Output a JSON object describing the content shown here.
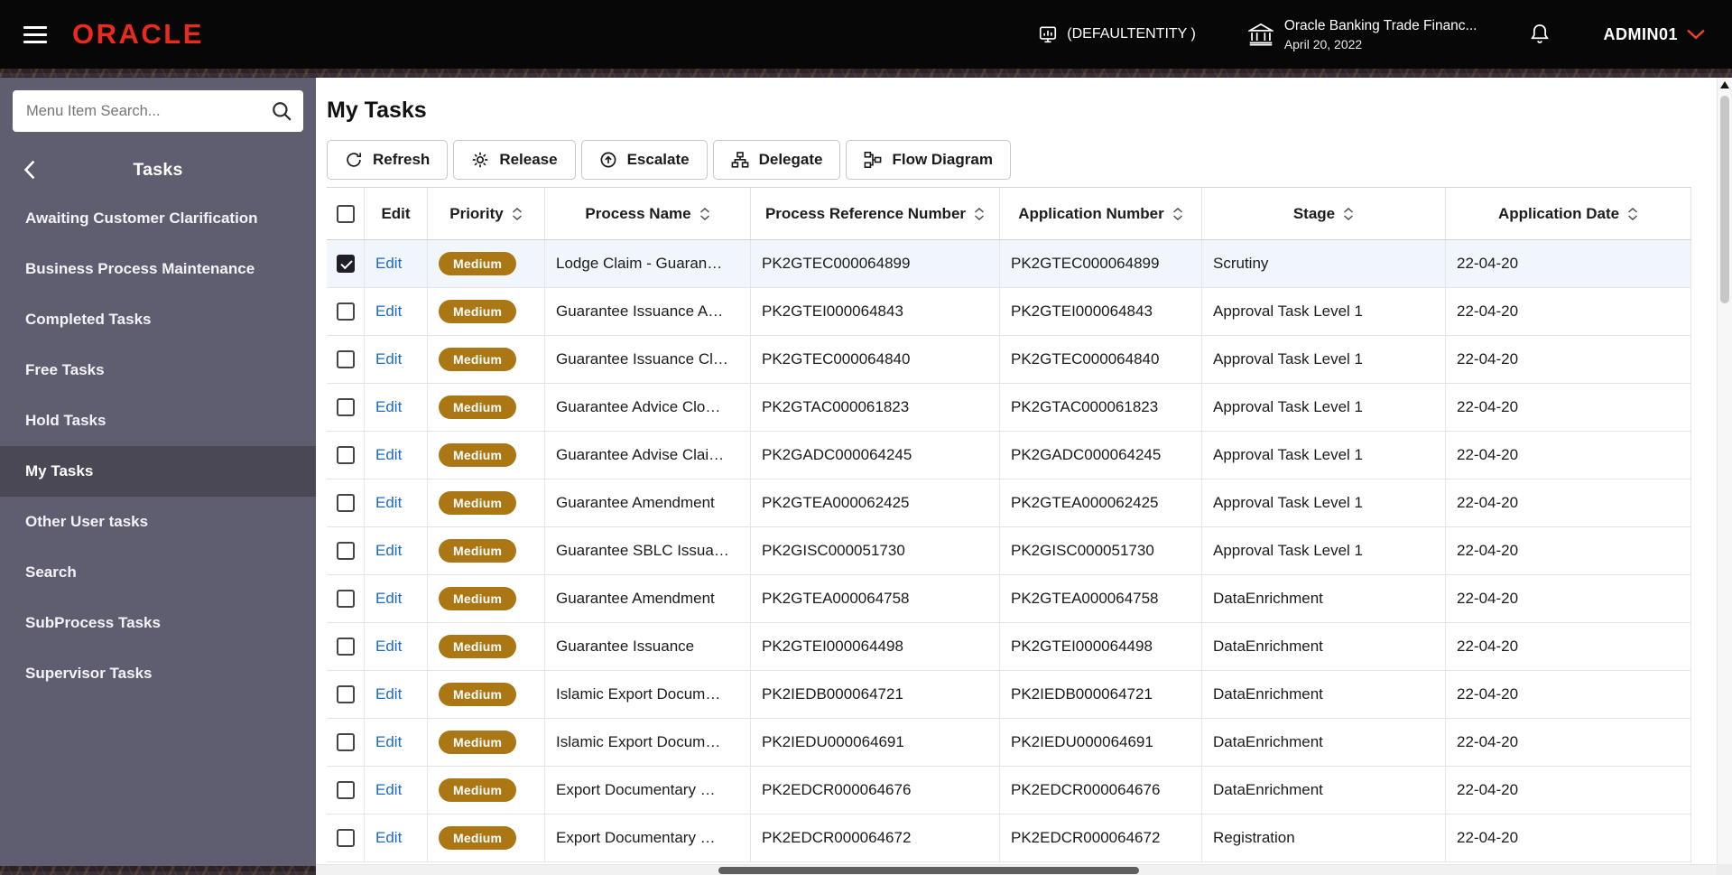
{
  "colors": {
    "brand_red": "#ea2a1d",
    "header_bg": "#070707",
    "sidebar_bg": "#5f5e71",
    "sidebar_active_bg": "#4a4855",
    "badge_bg": "#aa7714",
    "link_blue": "#1a6ac7",
    "selected_row_bg": "#f0f6fc"
  },
  "header": {
    "logo": "ORACLE",
    "entity_label": "(DEFAULTENTITY )",
    "app_title": "Oracle Banking Trade Financ...",
    "app_date": "April 20, 2022",
    "username": "ADMIN01",
    "icons": [
      "hamburger-icon",
      "entity-chart-icon",
      "bank-icon",
      "bell-icon",
      "chevron-down-icon"
    ]
  },
  "sidebar": {
    "search_placeholder": "Menu Item Search...",
    "section_title": "Tasks",
    "items": [
      {
        "label": "Awaiting Customer Clarification",
        "active": false
      },
      {
        "label": "Business Process Maintenance",
        "active": false
      },
      {
        "label": "Completed Tasks",
        "active": false
      },
      {
        "label": "Free Tasks",
        "active": false
      },
      {
        "label": "Hold Tasks",
        "active": false
      },
      {
        "label": "My Tasks",
        "active": true
      },
      {
        "label": "Other User tasks",
        "active": false
      },
      {
        "label": "Search",
        "active": false
      },
      {
        "label": "SubProcess Tasks",
        "active": false
      },
      {
        "label": "Supervisor Tasks",
        "active": false
      }
    ]
  },
  "main": {
    "title": "My Tasks",
    "toolbar": [
      {
        "label": "Refresh",
        "icon": "refresh-icon"
      },
      {
        "label": "Release",
        "icon": "release-gear-icon"
      },
      {
        "label": "Escalate",
        "icon": "escalate-up-arrow-icon"
      },
      {
        "label": "Delegate",
        "icon": "delegate-org-icon"
      },
      {
        "label": "Flow Diagram",
        "icon": "flow-diagram-icon"
      }
    ],
    "table": {
      "columns": [
        {
          "label": "",
          "sortable": false
        },
        {
          "label": "Edit",
          "sortable": false
        },
        {
          "label": "Priority",
          "sortable": true
        },
        {
          "label": "Process Name",
          "sortable": true
        },
        {
          "label": "Process Reference Number",
          "sortable": true
        },
        {
          "label": "Application Number",
          "sortable": true
        },
        {
          "label": "Stage",
          "sortable": true
        },
        {
          "label": "Application Date",
          "sortable": true
        }
      ],
      "rows": [
        {
          "checked": true,
          "edit": "Edit",
          "priority": "Medium",
          "process_name": "Lodge Claim - Guaran…",
          "process_ref": "PK2GTEC000064899",
          "application_number": "PK2GTEC000064899",
          "stage": "Scrutiny",
          "application_date": "22-04-20"
        },
        {
          "checked": false,
          "edit": "Edit",
          "priority": "Medium",
          "process_name": "Guarantee Issuance A…",
          "process_ref": "PK2GTEI000064843",
          "application_number": "PK2GTEI000064843",
          "stage": "Approval Task Level 1",
          "application_date": "22-04-20"
        },
        {
          "checked": false,
          "edit": "Edit",
          "priority": "Medium",
          "process_name": "Guarantee Issuance Cl…",
          "process_ref": "PK2GTEC000064840",
          "application_number": "PK2GTEC000064840",
          "stage": "Approval Task Level 1",
          "application_date": "22-04-20"
        },
        {
          "checked": false,
          "edit": "Edit",
          "priority": "Medium",
          "process_name": "Guarantee Advice Clo…",
          "process_ref": "PK2GTAC000061823",
          "application_number": "PK2GTAC000061823",
          "stage": "Approval Task Level 1",
          "application_date": "22-04-20"
        },
        {
          "checked": false,
          "edit": "Edit",
          "priority": "Medium",
          "process_name": "Guarantee Advise Clai…",
          "process_ref": "PK2GADC000064245",
          "application_number": "PK2GADC000064245",
          "stage": "Approval Task Level 1",
          "application_date": "22-04-20"
        },
        {
          "checked": false,
          "edit": "Edit",
          "priority": "Medium",
          "process_name": "Guarantee Amendment",
          "process_ref": "PK2GTEA000062425",
          "application_number": "PK2GTEA000062425",
          "stage": "Approval Task Level 1",
          "application_date": "22-04-20"
        },
        {
          "checked": false,
          "edit": "Edit",
          "priority": "Medium",
          "process_name": "Guarantee SBLC Issua…",
          "process_ref": "PK2GISC000051730",
          "application_number": "PK2GISC000051730",
          "stage": "Approval Task Level 1",
          "application_date": "22-04-20"
        },
        {
          "checked": false,
          "edit": "Edit",
          "priority": "Medium",
          "process_name": "Guarantee Amendment",
          "process_ref": "PK2GTEA000064758",
          "application_number": "PK2GTEA000064758",
          "stage": "DataEnrichment",
          "application_date": "22-04-20"
        },
        {
          "checked": false,
          "edit": "Edit",
          "priority": "Medium",
          "process_name": "Guarantee Issuance",
          "process_ref": "PK2GTEI000064498",
          "application_number": "PK2GTEI000064498",
          "stage": "DataEnrichment",
          "application_date": "22-04-20"
        },
        {
          "checked": false,
          "edit": "Edit",
          "priority": "Medium",
          "process_name": "Islamic Export Docum…",
          "process_ref": "PK2IEDB000064721",
          "application_number": "PK2IEDB000064721",
          "stage": "DataEnrichment",
          "application_date": "22-04-20"
        },
        {
          "checked": false,
          "edit": "Edit",
          "priority": "Medium",
          "process_name": "Islamic Export Docum…",
          "process_ref": "PK2IEDU000064691",
          "application_number": "PK2IEDU000064691",
          "stage": "DataEnrichment",
          "application_date": "22-04-20"
        },
        {
          "checked": false,
          "edit": "Edit",
          "priority": "Medium",
          "process_name": "Export Documentary …",
          "process_ref": "PK2EDCR000064676",
          "application_number": "PK2EDCR000064676",
          "stage": "DataEnrichment",
          "application_date": "22-04-20"
        },
        {
          "checked": false,
          "edit": "Edit",
          "priority": "Medium",
          "process_name": "Export Documentary …",
          "process_ref": "PK2EDCR000064672",
          "application_number": "PK2EDCR000064672",
          "stage": "Registration",
          "application_date": "22-04-20"
        }
      ]
    }
  }
}
